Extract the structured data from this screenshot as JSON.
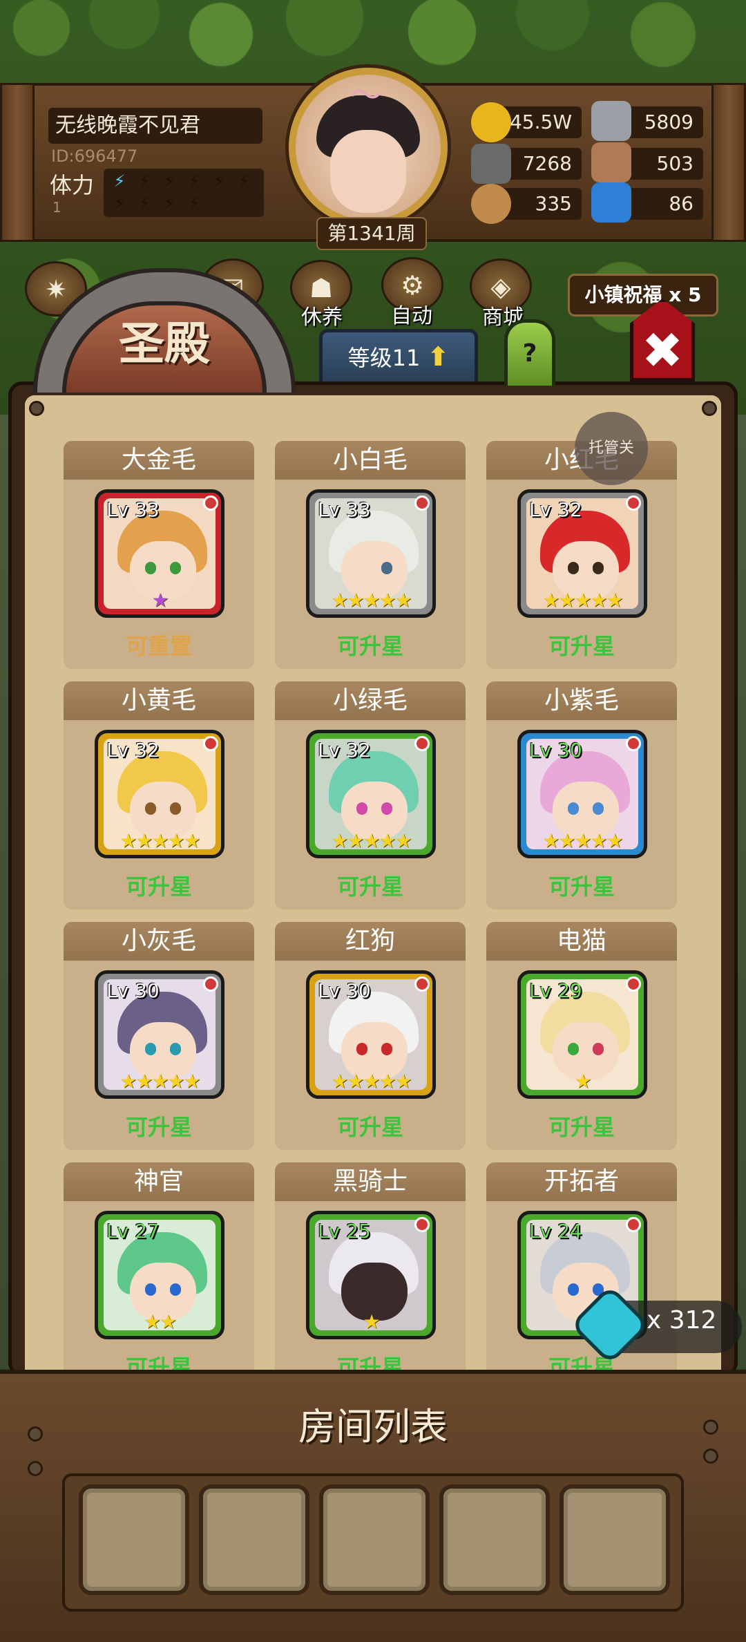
{
  "player": {
    "name": "无线晚霞不见君",
    "id_text": "ID:696477",
    "stamina_label": "体力",
    "stamina_count": "1",
    "week_label": "第1341周"
  },
  "resources": [
    {
      "icon": "gold-coin-icon",
      "value": "45.5W"
    },
    {
      "icon": "iron-ingot-icon",
      "value": "5809"
    },
    {
      "icon": "stone-ore-icon",
      "value": "7268"
    },
    {
      "icon": "leather-icon",
      "value": "503"
    },
    {
      "icon": "wood-log-icon",
      "value": "335"
    },
    {
      "icon": "crystal-icon",
      "value": "86"
    }
  ],
  "nav": {
    "rest_label": "休养",
    "auto_label": "自动",
    "shop_label": "商城",
    "blessing_label": "小镇祝福 x 5"
  },
  "sanctum": {
    "title": "圣殿",
    "level_label": "等级11",
    "help_label": "?",
    "trustee_label": "托管关"
  },
  "heroes": [
    {
      "name": "大金毛",
      "level": "Lv 33",
      "stars": "★",
      "status": "可重置"
    },
    {
      "name": "小白毛",
      "level": "Lv 33",
      "stars": "★★★★★",
      "status": "可升星"
    },
    {
      "name": "小红毛",
      "level": "Lv 32",
      "stars": "★★★★★",
      "status": "可升星"
    },
    {
      "name": "小黄毛",
      "level": "Lv 32",
      "stars": "★★★★★",
      "status": "可升星"
    },
    {
      "name": "小绿毛",
      "level": "Lv 32",
      "stars": "★★★★★",
      "status": "可升星"
    },
    {
      "name": "小紫毛",
      "level": "Lv 30",
      "stars": "★★★★★",
      "status": "可升星"
    },
    {
      "name": "小灰毛",
      "level": "Lv 30",
      "stars": "★★★★★",
      "status": "可升星"
    },
    {
      "name": "红狗",
      "level": "Lv 30",
      "stars": "★★★★★",
      "status": "可升星"
    },
    {
      "name": "电猫",
      "level": "Lv 29",
      "stars": "★",
      "status": "可升星"
    },
    {
      "name": "神官",
      "level": "Lv 27",
      "stars": "★★",
      "status": "可升星"
    },
    {
      "name": "黑骑士",
      "level": "Lv 25",
      "stars": "★",
      "status": "可升星"
    },
    {
      "name": "开拓者",
      "level": "Lv 24",
      "stars": "★",
      "status": "可升星"
    }
  ],
  "gem": {
    "count": "x 312"
  },
  "rooms": {
    "title": "房间列表"
  }
}
